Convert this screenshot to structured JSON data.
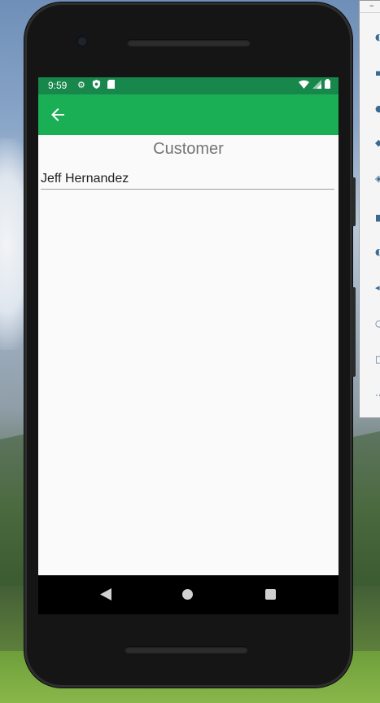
{
  "status_bar": {
    "time": "9:59",
    "left_icons": [
      "gear-icon",
      "shield-icon",
      "sd-card-icon"
    ],
    "right_icons": [
      "wifi-icon",
      "signal-icon",
      "battery-icon"
    ]
  },
  "toolbar": {
    "back_icon": "arrow-back-icon",
    "color": "#1aaf54"
  },
  "main": {
    "title": "Customer",
    "customer_name_value": "Jeff Hernandez"
  },
  "navigation_bar": {
    "buttons": [
      "back-triangle-icon",
      "home-circle-icon",
      "recents-square-icon"
    ]
  },
  "colors": {
    "status_bar": "#17874b",
    "app_bar": "#1aaf54",
    "screen_bg": "#fafafa",
    "title_text": "#757575"
  }
}
